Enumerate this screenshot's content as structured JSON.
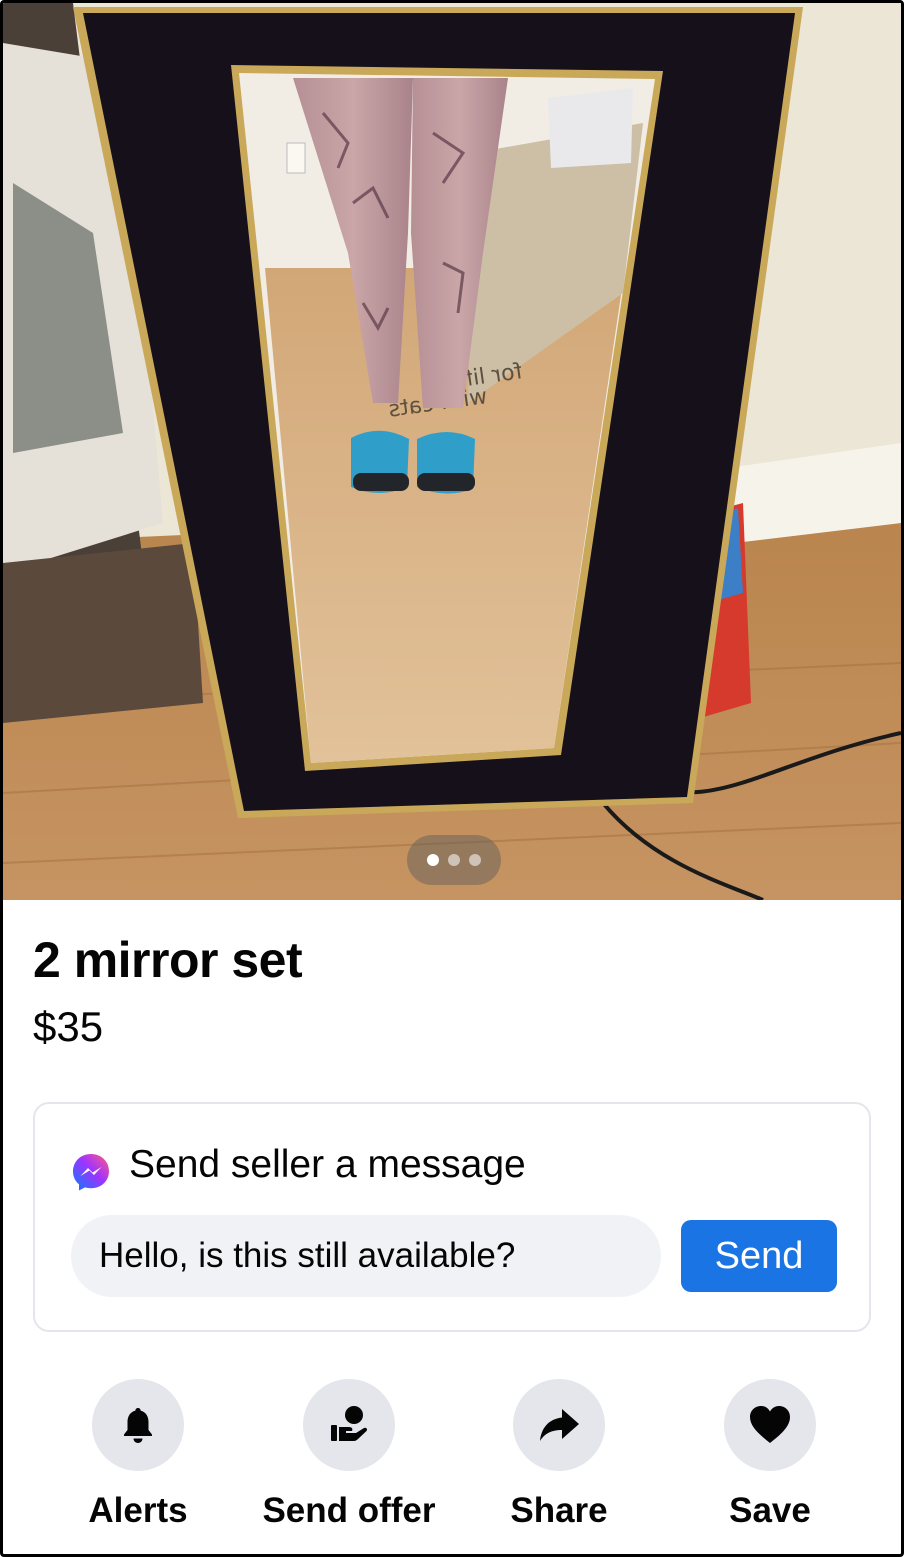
{
  "listing": {
    "title": "2 mirror set",
    "price": "$35",
    "photo": {
      "image_count": 3,
      "active_index": 0,
      "box_text_line1": "for life",
      "box_text_line2": "with cats"
    }
  },
  "message_card": {
    "heading": "Send seller a message",
    "icon": "messenger-icon",
    "input_value": "Hello, is this still available?",
    "send_label": "Send"
  },
  "actions": [
    {
      "label": "Alerts",
      "icon": "bell-icon"
    },
    {
      "label": "Send offer",
      "icon": "offer-hand-icon"
    },
    {
      "label": "Share",
      "icon": "share-arrow-icon"
    },
    {
      "label": "Save",
      "icon": "heart-icon"
    }
  ],
  "colors": {
    "accent": "#1b74e4",
    "button_bg": "#e4e6eb",
    "input_bg": "#f0f2f5",
    "text": "#050505"
  }
}
